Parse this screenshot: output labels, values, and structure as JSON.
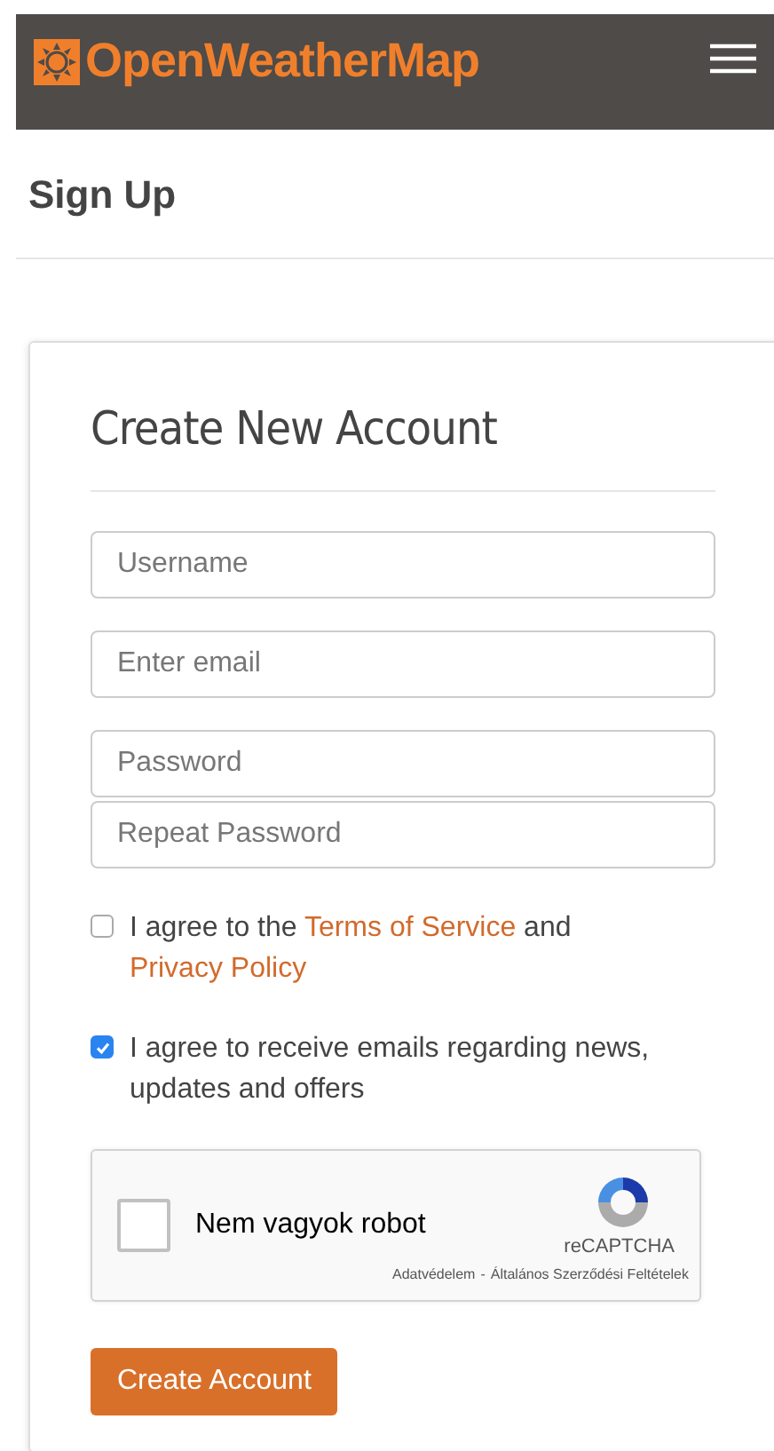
{
  "header": {
    "logo_text": "OpenWeatherMap"
  },
  "page_title": "Sign Up",
  "form": {
    "title": "Create New Account",
    "fields": [
      {
        "placeholder": "Username"
      },
      {
        "placeholder": "Enter email"
      },
      {
        "placeholder": "Password"
      },
      {
        "placeholder": "Repeat Password"
      }
    ],
    "agreements": [
      {
        "kind": "terms",
        "checked": false,
        "before": "I agree to the",
        "link1": "Terms of Service",
        "middle": "and",
        "link2": "Privacy Policy"
      },
      {
        "kind": "plain",
        "checked": true,
        "text": "I agree to receive emails regarding news, updates and offers"
      }
    ],
    "captcha": {
      "checked": false,
      "label": "Nem vagyok robot",
      "brand": "reCAPTCHA",
      "privacy": "Adatvédelem",
      "separator": "-",
      "terms": "Általános Szerződési Feltételek"
    },
    "submit": "Create Account"
  }
}
